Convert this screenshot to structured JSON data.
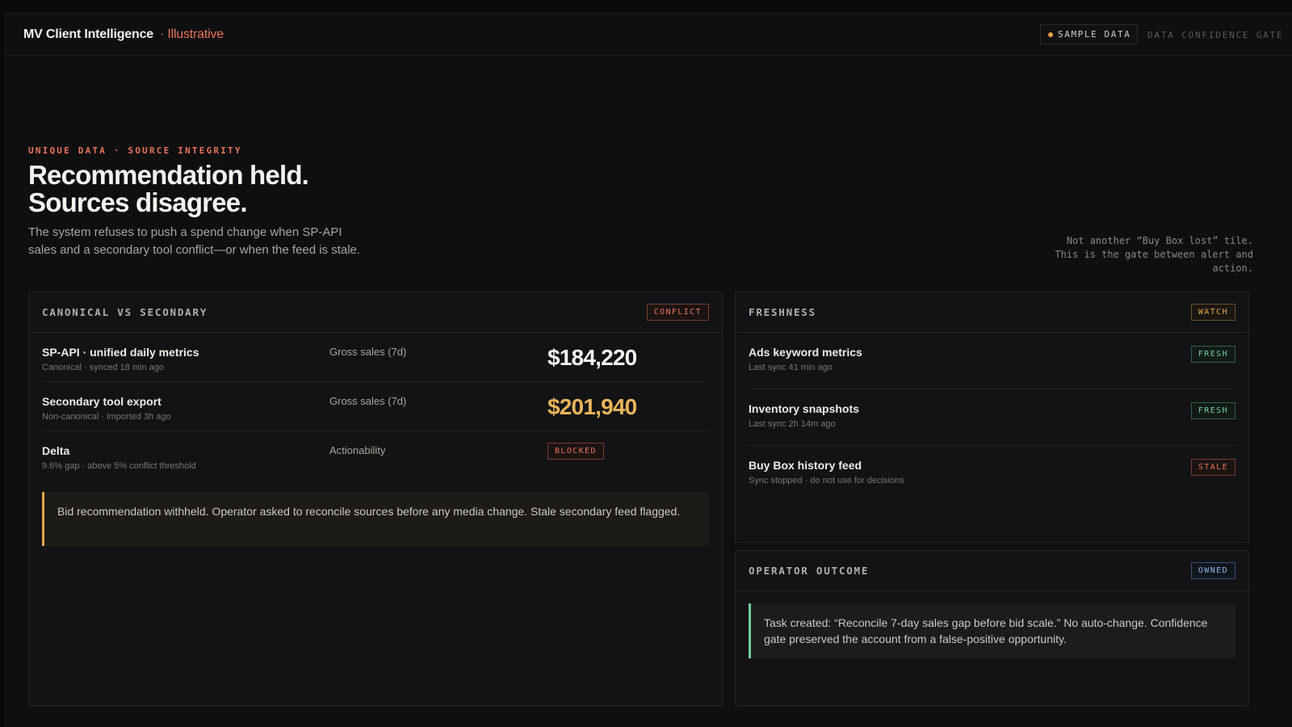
{
  "app": {
    "title": "MV Client Intelligence",
    "tag": "· Illustrative",
    "sample_label": "SAMPLE DATA",
    "gate_label": "DATA CONFIDENCE GATE"
  },
  "hero": {
    "eyebrow": "UNIQUE DATA · SOURCE INTEGRITY",
    "headline_1": "Recommendation held.",
    "headline_2": "Sources disagree.",
    "subtext": "The system refuses to push a spend change when SP-API sales and a secondary tool conflict—or when the feed is stale.",
    "sidenote_1": "Not another “Buy Box lost” tile.",
    "sidenote_2": "This is the gate between alert and action."
  },
  "canonical": {
    "title": "CANONICAL VS SECONDARY",
    "badge": "CONFLICT",
    "rows": [
      {
        "title": "SP-API · unified daily metrics",
        "sub": "Canonical · synced 18 min ago",
        "metric": "Gross sales (7d)",
        "value": "$184,220"
      },
      {
        "title": "Secondary tool export",
        "sub": "Non-canonical · imported 3h ago",
        "metric": "Gross sales (7d)",
        "value": "$201,940"
      },
      {
        "title": "Delta",
        "sub": "9.6% gap · above 5% conflict threshold",
        "metric": "Actionability",
        "badge": "BLOCKED"
      }
    ],
    "callout": "Bid recommendation withheld. Operator asked to reconcile sources before any media change. Stale secondary feed flagged."
  },
  "freshness": {
    "title": "FRESHNESS",
    "badge": "WATCH",
    "rows": [
      {
        "title": "Ads keyword metrics",
        "sub": "Last sync 41 min ago",
        "badge": "FRESH"
      },
      {
        "title": "Inventory snapshots",
        "sub": "Last sync 2h 14m ago",
        "badge": "FRESH"
      },
      {
        "title": "Buy Box history feed",
        "sub": "Sync stopped · do not use for decisions",
        "badge": "STALE"
      }
    ]
  },
  "outcome": {
    "title": "OPERATOR OUTCOME",
    "badge": "OWNED",
    "text": "Task created: “Reconcile 7-day sales gap before bid scale.” No auto-change. Confidence gate preserved the account from a false-positive opportunity."
  },
  "colors": {
    "accent": "#e8735a",
    "warning": "#e3a548",
    "fresh": "#6fcf97",
    "owned": "#8fb4ef",
    "background": "#0f0f10"
  }
}
